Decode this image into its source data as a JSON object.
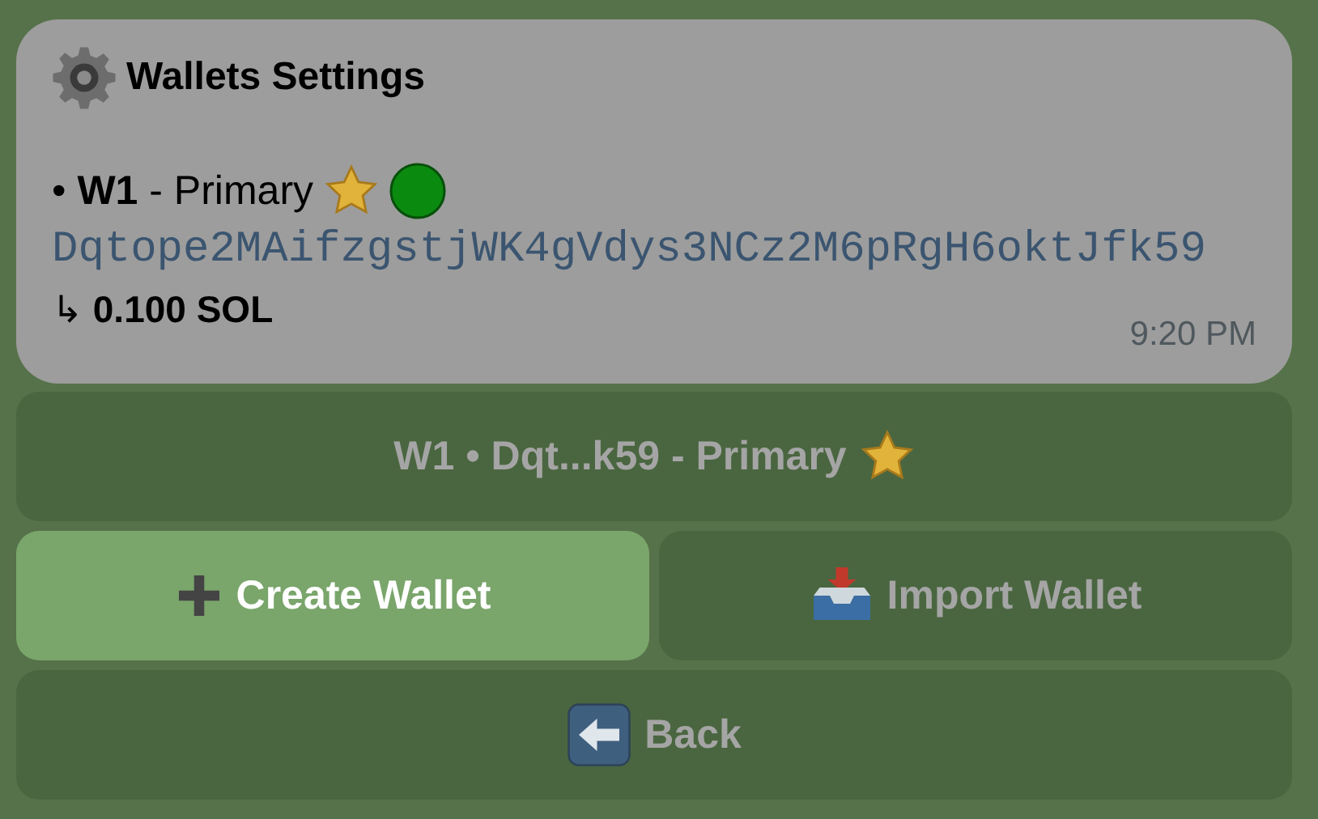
{
  "message": {
    "title": "Wallets Settings",
    "wallets": [
      {
        "bullet": "•",
        "name": "W1",
        "label": "- Primary",
        "primary": true,
        "active": true,
        "address": "Dqtope2MAifzgstjWK4gVdys3NCz2M6pRgH6oktJfk59",
        "arrow": "↳",
        "balance": "0.100 SOL"
      }
    ],
    "time": "9:20 PM"
  },
  "keyboard": {
    "rows": [
      [
        {
          "label": "W1 • Dqt...k59 - Primary",
          "kind": "star",
          "selected": false
        }
      ],
      [
        {
          "label": "Create Wallet",
          "kind": "plus",
          "selected": true
        },
        {
          "label": "Import Wallet",
          "kind": "inbox",
          "selected": false
        }
      ],
      [
        {
          "label": "Back",
          "kind": "back",
          "selected": false
        }
      ]
    ]
  }
}
